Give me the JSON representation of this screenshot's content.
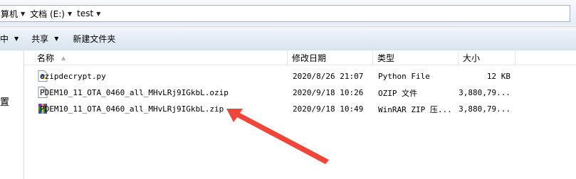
{
  "address_bar": {
    "segment1": "算机",
    "segment2": "文档 (E:)",
    "segment3": "test"
  },
  "toolbar": {
    "organize_label": "中",
    "share_label": "共享",
    "new_folder_label": "新建文件夹"
  },
  "nav": {
    "visible_label": "置"
  },
  "columns": {
    "name": "名称",
    "modified": "修改日期",
    "type": "类型",
    "size": "大小"
  },
  "files": [
    {
      "name": "ozipdecrypt.py",
      "modified": "2020/8/26 21:07",
      "type": "Python File",
      "size": "12 KB",
      "icon": "python-file-icon"
    },
    {
      "name": "PDEM10_11_OTA_0460_all_MHvLRj9IGkbL.ozip",
      "modified": "2020/9/18 10:26",
      "type": "OZIP 文件",
      "size": "3,880,79...",
      "icon": "generic-file-icon"
    },
    {
      "name": "PDEM10_11_OTA_0460_all_MHvLRj9IGkbL.zip",
      "modified": "2020/9/18 10:49",
      "type": "WinRAR ZIP 压...",
      "size": "3,880,79...",
      "icon": "winrar-archive-icon"
    }
  ],
  "annotation": {
    "arrow_color": "#f0463a"
  }
}
